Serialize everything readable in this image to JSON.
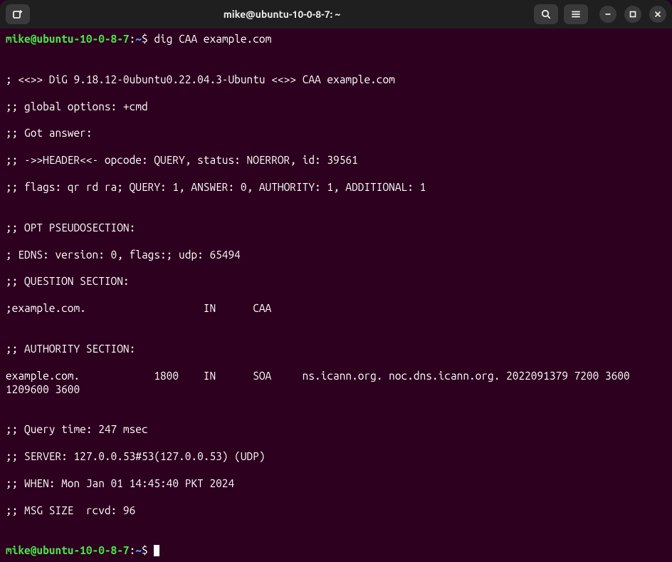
{
  "titlebar": {
    "title": "mike@ubuntu-10-0-8-7: ~"
  },
  "prompt": {
    "user_host": "mike@ubuntu-10-0-8-7",
    "colon": ":",
    "path": "~",
    "symbol": "$"
  },
  "command": "dig CAA example.com",
  "output": {
    "l1": "",
    "l2": "; <<>> DiG 9.18.12-0ubuntu0.22.04.3-Ubuntu <<>> CAA example.com",
    "l3": ";; global options: +cmd",
    "l4": ";; Got answer:",
    "l5": ";; ->>HEADER<<- opcode: QUERY, status: NOERROR, id: 39561",
    "l6": ";; flags: qr rd ra; QUERY: 1, ANSWER: 0, AUTHORITY: 1, ADDITIONAL: 1",
    "l7": "",
    "l8": ";; OPT PSEUDOSECTION:",
    "l9": "; EDNS: version: 0, flags:; udp: 65494",
    "l10": ";; QUESTION SECTION:",
    "l11": ";example.com.                   IN      CAA",
    "l12": "",
    "l13": ";; AUTHORITY SECTION:",
    "l14": "example.com.            1800    IN      SOA     ns.icann.org. noc.dns.icann.org. 2022091379 7200 3600 1209600 3600",
    "l15": "",
    "l16": ";; Query time: 247 msec",
    "l17": ";; SERVER: 127.0.0.53#53(127.0.0.53) (UDP)",
    "l18": ";; WHEN: Mon Jan 01 14:45:40 PKT 2024",
    "l19": ";; MSG SIZE  rcvd: 96",
    "l20": ""
  }
}
